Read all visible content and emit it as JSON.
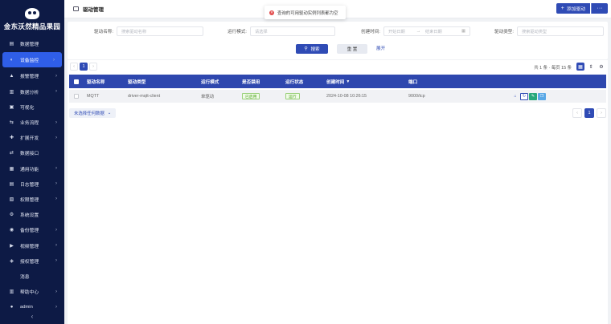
{
  "sidebar": {
    "brand": "金东沃然精品果园",
    "items": [
      {
        "label": "数据管理",
        "icon": "table-icon",
        "glyph": "▤",
        "arrow": false,
        "active": false
      },
      {
        "label": "设备监控",
        "icon": "monitor-icon",
        "glyph": "◐",
        "arrow": true,
        "active": true
      },
      {
        "label": "报警管理",
        "icon": "alarm-icon",
        "glyph": "▲",
        "arrow": true,
        "active": false
      },
      {
        "label": "数据分析",
        "icon": "analysis-icon",
        "glyph": "▥",
        "arrow": true,
        "active": false
      },
      {
        "label": "可视化",
        "icon": "visual-icon",
        "glyph": "▣",
        "arrow": false,
        "active": false
      },
      {
        "label": "业务流程",
        "icon": "flow-icon",
        "glyph": "⇆",
        "arrow": true,
        "active": false
      },
      {
        "label": "扩展开发",
        "icon": "extend-icon",
        "glyph": "✚",
        "arrow": true,
        "active": false
      },
      {
        "label": "数据接口",
        "icon": "interface-icon",
        "glyph": "⇄",
        "arrow": false,
        "active": false
      },
      {
        "label": "通用功能",
        "icon": "common-icon",
        "glyph": "▦",
        "arrow": true,
        "active": false
      },
      {
        "label": "日志管理",
        "icon": "log-icon",
        "glyph": "▤",
        "arrow": true,
        "active": false
      },
      {
        "label": "权限管理",
        "icon": "permission-icon",
        "glyph": "▧",
        "arrow": true,
        "active": false
      },
      {
        "label": "系统设置",
        "icon": "gear-icon",
        "glyph": "⚙",
        "arrow": false,
        "active": false
      },
      {
        "label": "备份管理",
        "icon": "backup-icon",
        "glyph": "◉",
        "arrow": true,
        "active": false
      },
      {
        "label": "视频管理",
        "icon": "video-icon",
        "glyph": "▶",
        "arrow": true,
        "active": false
      },
      {
        "label": "授权管理",
        "icon": "license-icon",
        "glyph": "◈",
        "arrow": true,
        "active": false
      },
      {
        "label": "消息",
        "icon": "message-icon",
        "glyph": "",
        "arrow": false,
        "active": false
      },
      {
        "label": "帮助中心",
        "icon": "help-icon",
        "glyph": "▥",
        "arrow": true,
        "active": false
      },
      {
        "label": "admin",
        "icon": "user-icon",
        "glyph": "●",
        "arrow": true,
        "active": false
      }
    ],
    "collapse": "‹"
  },
  "topbar": {
    "title": "驱动管理",
    "add_label": "添加驱动",
    "more_label": "···"
  },
  "toast": {
    "message": "查询的可用驱动实例列表都为空"
  },
  "search": {
    "name_label": "驱动名称:",
    "name_placeholder": "搜索驱动名称",
    "mode_label": "运行模式:",
    "mode_placeholder": "请选择",
    "time_label": "创建时间:",
    "start_placeholder": "开始日期",
    "time_sep": "→",
    "end_placeholder": "结束日期",
    "type_label": "驱动类型:",
    "type_placeholder": "搜索驱动类型",
    "search_btn": "搜索",
    "reset_btn": "重 置",
    "expand_btn": "展开"
  },
  "pager": {
    "current": "1",
    "prev": "‹",
    "next": "›",
    "info": "共 1 条 · 每页 15 条"
  },
  "table": {
    "headers": {
      "name": "驱动名称",
      "type": "驱动类型",
      "mode": "运行模式",
      "disabled": "是否禁用",
      "status": "运行状态",
      "created": "创建时间",
      "port": "端口"
    },
    "rows": [
      {
        "name": "MQTT",
        "type": "driver-mqtt-client",
        "mode": "单驱动",
        "disabled": "已启用",
        "status": "运行",
        "created": "2024-10-08 10:26:15",
        "port": "9000/tcp"
      }
    ]
  },
  "footer": {
    "selection_note": "未选择任何数据",
    "selection_arrow": "⌄"
  },
  "colors": {
    "sidebar_bg": "#0d1a45",
    "accent": "#2f4bb5",
    "active_menu": "#2f5ee8",
    "success": "#4ba31c",
    "error": "#e24b4b"
  }
}
